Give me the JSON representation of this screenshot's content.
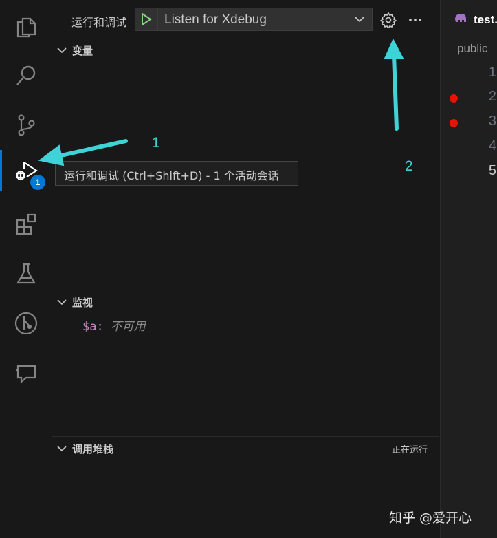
{
  "activity_bar": {
    "items": [
      {
        "name": "explorer-icon"
      },
      {
        "name": "search-icon"
      },
      {
        "name": "source-control-icon"
      },
      {
        "name": "run-debug-icon",
        "badge": "1"
      },
      {
        "name": "extensions-icon"
      },
      {
        "name": "testing-icon"
      },
      {
        "name": "git-graph-icon"
      },
      {
        "name": "chat-icon"
      }
    ],
    "active_color": "#0078d4"
  },
  "toolbar": {
    "title": "运行和调试",
    "config": "Listen for Xdebug",
    "start_icon": "play-icon",
    "settings_icon": "gear-icon",
    "more_icon": "ellipsis-icon"
  },
  "sections": {
    "variables": {
      "title": "变量"
    },
    "watch": {
      "title": "监视",
      "expressions": [
        {
          "name": "$a",
          "colon": ":",
          "value": "不可用"
        }
      ]
    },
    "callstack": {
      "title": "调用堆栈",
      "status": "正在运行"
    }
  },
  "tooltip": {
    "text": "运行和调试 (Ctrl+Shift+D) - 1 个活动会话"
  },
  "editor": {
    "tab_label": "test.",
    "tab_icon": "php-elephant-icon",
    "breadcrumb": "public",
    "lines": [
      {
        "number": "1",
        "breakpoint": false,
        "current": false
      },
      {
        "number": "2",
        "breakpoint": true,
        "current": false
      },
      {
        "number": "3",
        "breakpoint": true,
        "current": false
      },
      {
        "number": "4",
        "breakpoint": false,
        "current": false
      },
      {
        "number": "5",
        "breakpoint": false,
        "current": true
      }
    ],
    "breakpoint_color": "#e51400"
  },
  "annotations": {
    "label_1": "1",
    "label_2": "2",
    "arrow_color": "#3fd2d6"
  },
  "watermark": "知乎 @爱开心"
}
